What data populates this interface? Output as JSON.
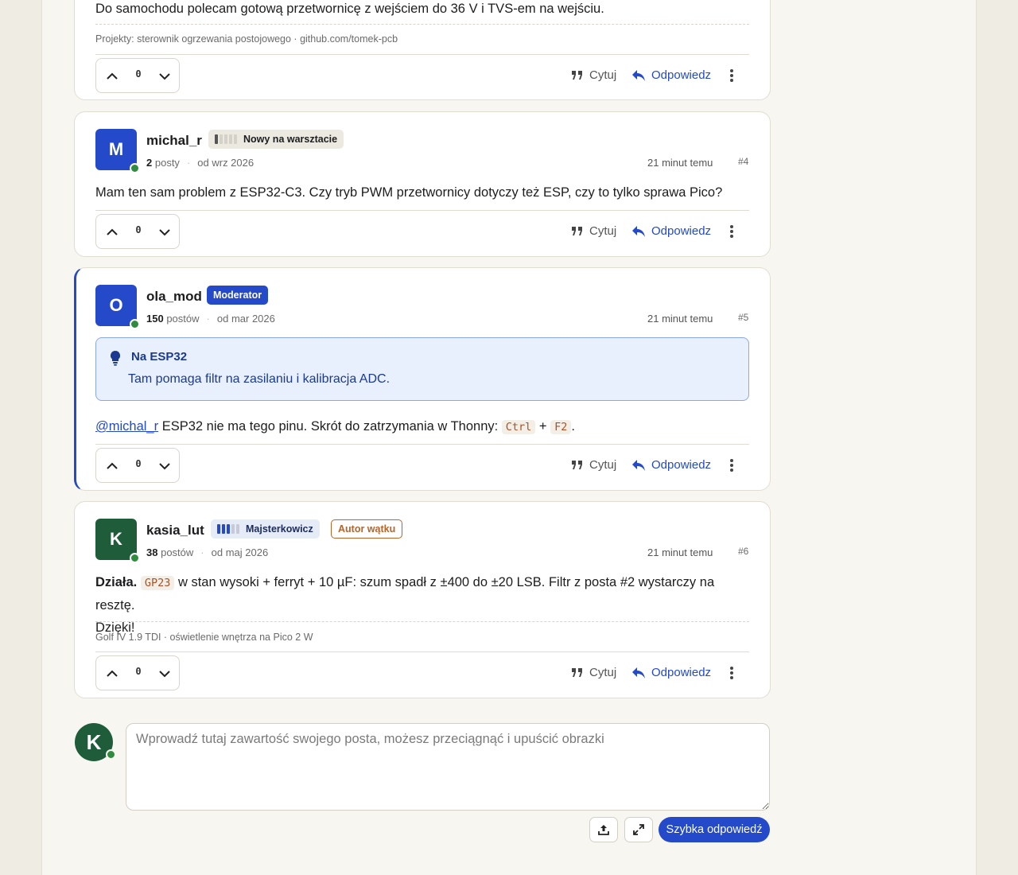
{
  "posts": [
    {
      "body": "Do samochodu polecam gotową przetwornicę z wejściem do 36 V i TVS-em na wejściu.",
      "signature": "Projekty: sterownik ogrzewania postojowego · github.com/tomek-pcb",
      "votes": "0"
    },
    {
      "number": "#4",
      "avatar_letter": "M",
      "avatar_color": "#2449c9",
      "username": "michal_r",
      "rank": "Nowy na warsztacie",
      "post_count": "2",
      "post_word": "posty",
      "since": "od wrz 2026",
      "time": "21 minut temu",
      "body": "Mam ten sam problem z ESP32-C3. Czy tryb PWM przetwornicy dotyczy też ESP, czy to tylko sprawa Pico?",
      "votes": "0"
    },
    {
      "number": "#5",
      "avatar_letter": "O",
      "avatar_color": "#2449c9",
      "username": "ola_mod",
      "role_badge": "Moderator",
      "post_count": "150",
      "post_word": "postów",
      "since": "od mar 2026",
      "time": "21 minut temu",
      "callout_title": "Na ESP32",
      "callout_text": "Tam pomaga filtr na zasilaniu i kalibracja ADC.",
      "mention": "@michal_r",
      "body_a": " ESP32 nie ma tego pinu. Skrót do zatrzymania w Thonny: ",
      "key1": "Ctrl",
      "plus": " + ",
      "key2": "F2",
      "body_end": ".",
      "votes": "0"
    },
    {
      "number": "#6",
      "avatar_letter": "K",
      "avatar_color": "#1f5d3a",
      "username": "kasia_lut",
      "rank": "Majsterkowicz",
      "author_badge": "Autor wątku",
      "post_count": "38",
      "post_word": "postów",
      "since": "od maj 2026",
      "time": "21 minut temu",
      "body_bold": "Działa.",
      "code": "GP23",
      "body_line1": " w stan wysoki + ferryt + 10 µF: szum spadł z ±400 do ±20 LSB. Filtr z posta #2 wystarczy na resztę.",
      "body_line2": "Dzięki!",
      "signature": "Golf IV 1.9 TDI · oświetlenie wnętrza na Pico 2 W",
      "votes": "0"
    }
  ],
  "actions": {
    "quote": "Cytuj",
    "reply": "Odpowiedz"
  },
  "composer": {
    "avatar_letter": "K",
    "placeholder": "Wprowadź tutaj zawartość swojego posta, możesz przeciągnąć i upuścić obrazki",
    "submit": "Szybka odpowiedź"
  },
  "colors": {
    "accent": "#2449c9",
    "online": "#2f8b3e",
    "code_text": "#a4532a",
    "author_badge": "#b5642a"
  }
}
